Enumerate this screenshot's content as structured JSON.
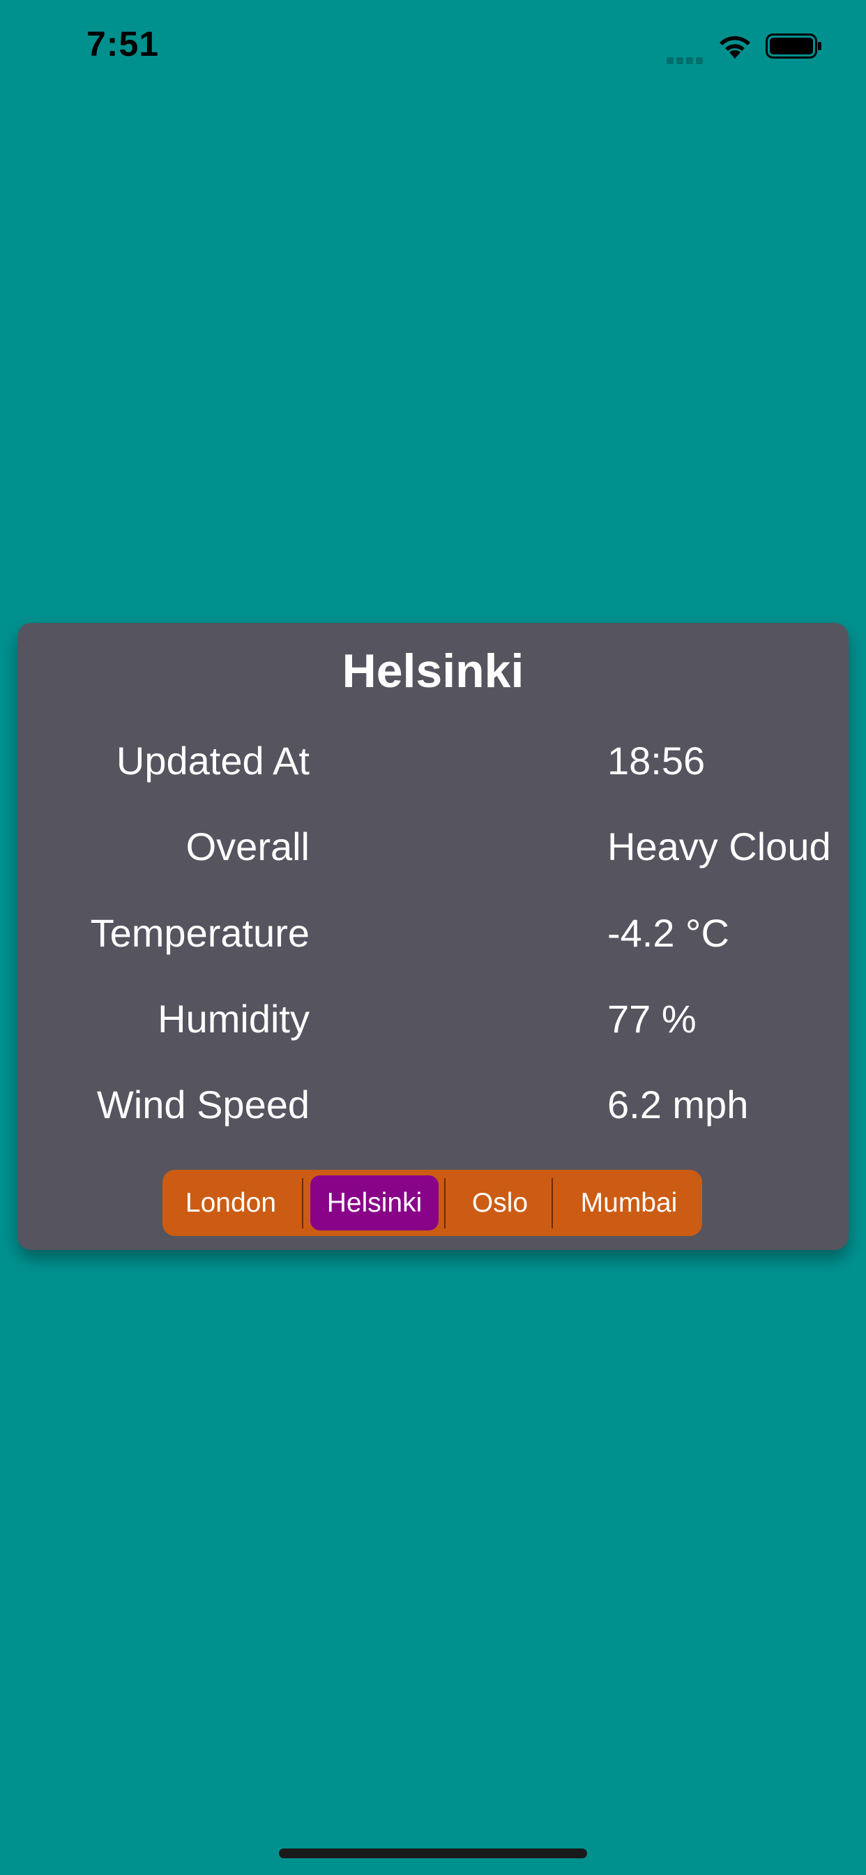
{
  "status_bar": {
    "time": "7:51",
    "icons": [
      "signal-icon",
      "wifi-icon",
      "battery-icon"
    ]
  },
  "colors": {
    "background": "#00918f",
    "card": "#56545f",
    "segment_bg": "#cc5c13",
    "segment_selected": "#880388",
    "text": "#ffffff"
  },
  "card": {
    "title": "Helsinki",
    "rows": [
      {
        "label": "Updated At",
        "value": "18:56"
      },
      {
        "label": "Overall",
        "value": "Heavy Cloud"
      },
      {
        "label": "Temperature",
        "value": "-4.2 °C"
      },
      {
        "label": "Humidity",
        "value": "77 %"
      },
      {
        "label": "Wind Speed",
        "value": "6.2 mph"
      }
    ]
  },
  "segmented": {
    "options": [
      "London",
      "Helsinki",
      "Oslo",
      "Mumbai"
    ],
    "selected": "Helsinki"
  }
}
